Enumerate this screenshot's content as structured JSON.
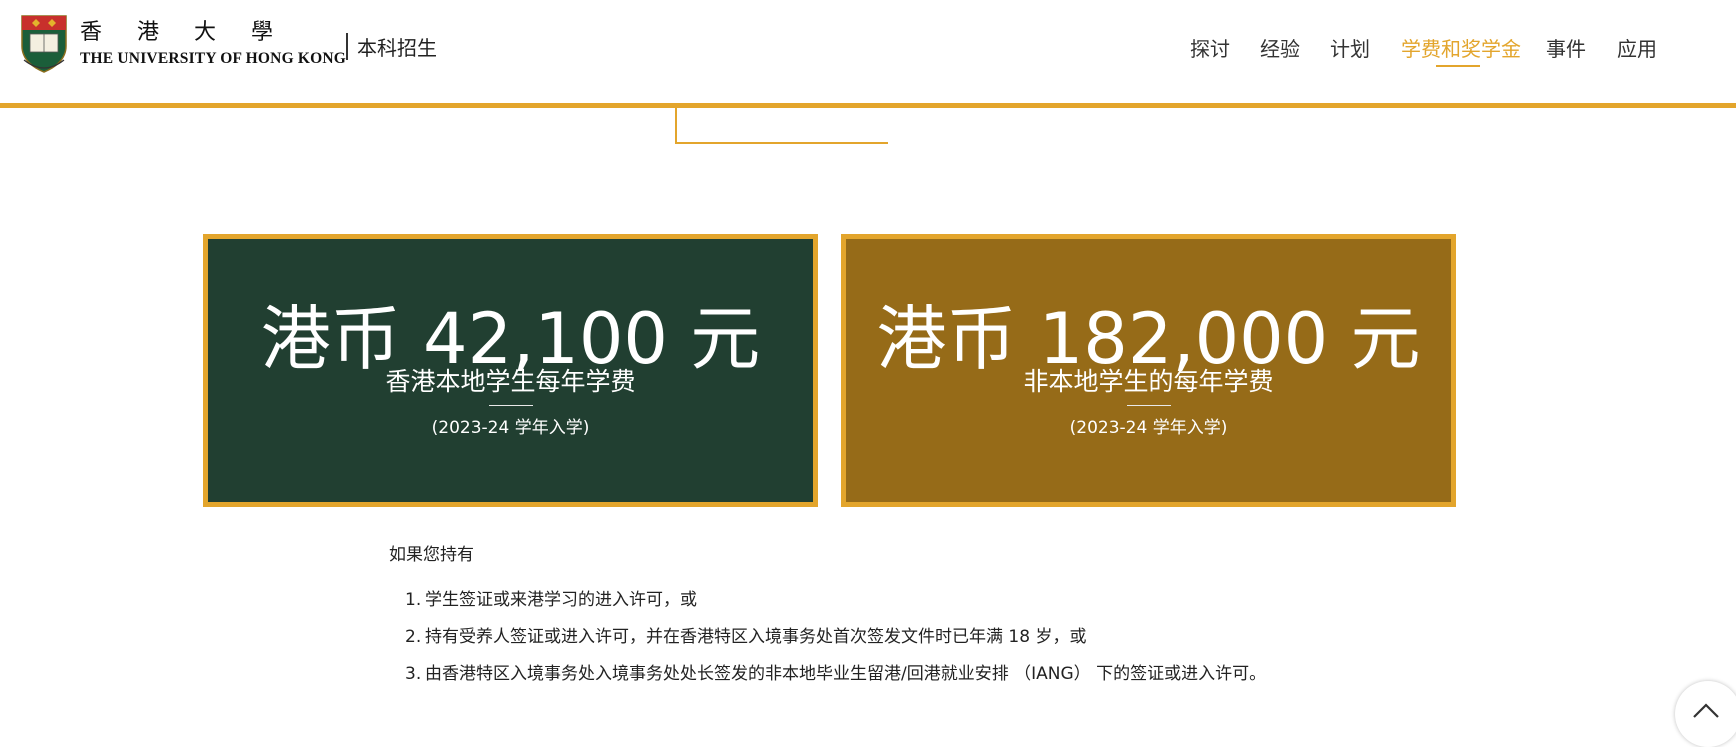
{
  "header": {
    "university_chinese": "香 港 大 學",
    "university_english": "THE UNIVERSITY OF HONG KONG",
    "crest_icon": "hku-crest-icon",
    "section_title": "本科招生"
  },
  "nav": {
    "items": [
      {
        "label": "探讨",
        "active": false
      },
      {
        "label": "经验",
        "active": false
      },
      {
        "label": "计划",
        "active": false
      },
      {
        "label": "学费和奖学金",
        "active": true
      },
      {
        "label": "事件",
        "active": false
      },
      {
        "label": "应用",
        "active": false
      }
    ]
  },
  "fees": {
    "local": {
      "amount": "港币 42,100 元",
      "label": "香港本地学生每年学费",
      "note": "(2023-24 学年入学)"
    },
    "nonlocal": {
      "amount": "港币 182,000 元",
      "label": "非本地学生的每年学费",
      "note": "(2023-24 学年入学)"
    }
  },
  "body": {
    "intro": "如果您持有",
    "conditions": [
      {
        "num": "1.",
        "text": "学生签证或来港学习的进入许可，或"
      },
      {
        "num": "2.",
        "text": "持有受养人签证或进入许可，并在香港特区入境事务处首次签发文件时已年满 18 岁，或"
      },
      {
        "num": "3.",
        "text": "由香港特区入境事务处入境事务处处长签发的非本地毕业生留港/回港就业安排 （IANG） 下的签证或进入许可。"
      }
    ]
  },
  "back_to_top": {
    "icon": "chevron-up-icon"
  },
  "colors": {
    "accent": "#e3a52c",
    "local_card": "#213f31",
    "nonlocal_card": "#966b18"
  }
}
